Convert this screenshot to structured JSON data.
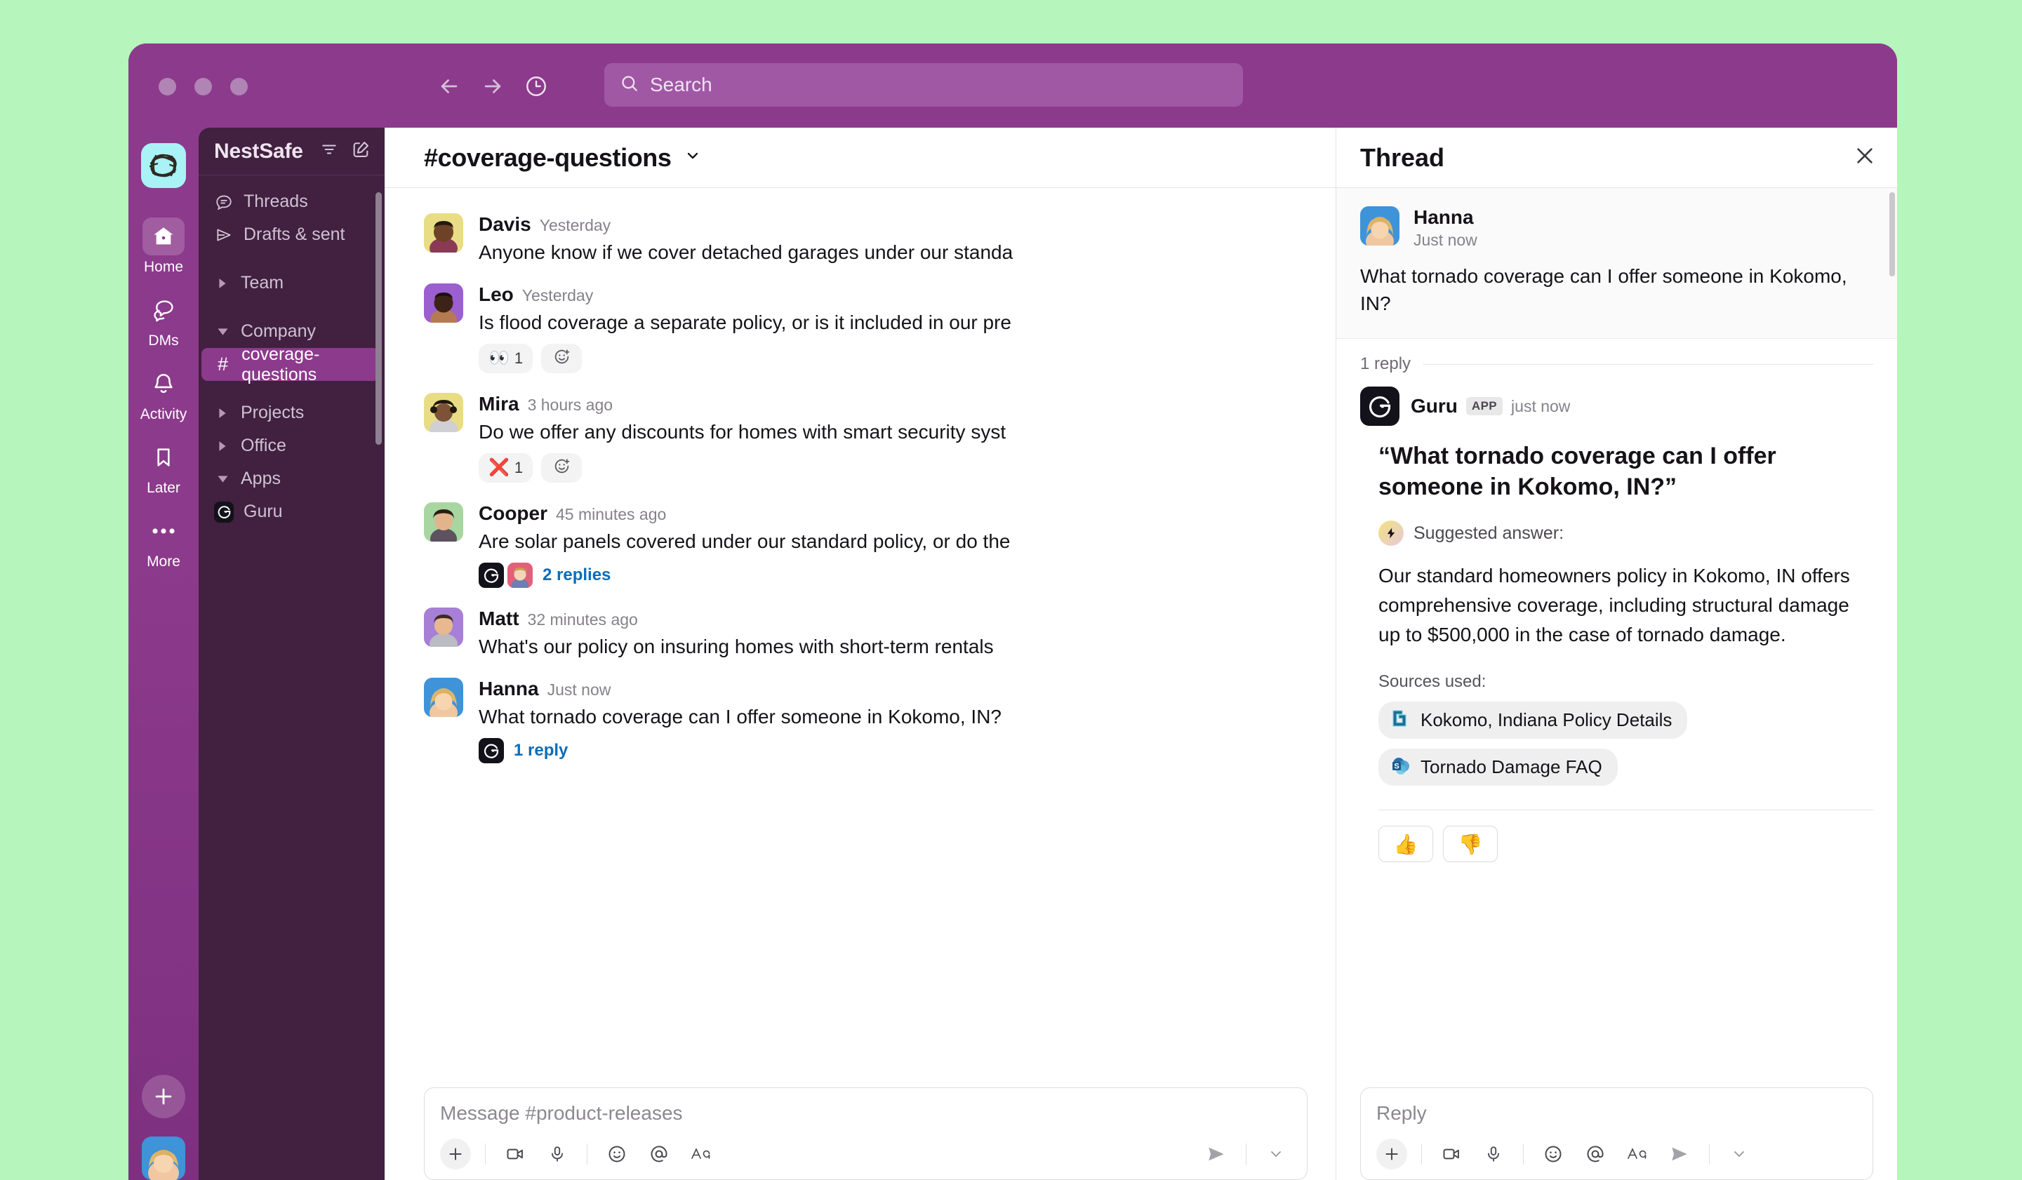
{
  "topbar": {
    "search_placeholder": "Search",
    "back_icon": "arrow-left-icon",
    "forward_icon": "arrow-right-icon",
    "history_icon": "clock-icon"
  },
  "rail": {
    "workspace_name": "NestSafe",
    "items": [
      {
        "label": "Home",
        "icon": "home-icon",
        "active": true
      },
      {
        "label": "DMs",
        "icon": "dms-icon",
        "active": false
      },
      {
        "label": "Activity",
        "icon": "bell-icon",
        "active": false
      },
      {
        "label": "Later",
        "icon": "bookmark-icon",
        "active": false
      },
      {
        "label": "More",
        "icon": "ellipsis-icon",
        "active": false
      }
    ],
    "new_label": "+"
  },
  "sidebar": {
    "title": "NestSafe",
    "filter_icon": "filter-icon",
    "compose_icon": "compose-icon",
    "items": [
      {
        "label": "Threads",
        "type": "nav",
        "icon": "threads-icon"
      },
      {
        "label": "Drafts & sent",
        "type": "nav",
        "icon": "drafts-icon"
      },
      {
        "label": "Team",
        "type": "section",
        "expanded": false
      },
      {
        "label": "Company",
        "type": "section",
        "expanded": true
      },
      {
        "label": "coverage-questions",
        "type": "channel",
        "active": true
      },
      {
        "label": "Projects",
        "type": "section",
        "expanded": false
      },
      {
        "label": "Office",
        "type": "section",
        "expanded": false
      },
      {
        "label": "Apps",
        "type": "section",
        "expanded": true
      },
      {
        "label": "Guru",
        "type": "app",
        "icon": "guru-icon"
      }
    ]
  },
  "channel": {
    "name": "#coverage-questions",
    "chevron_icon": "chevron-down-icon",
    "messages": [
      {
        "author": "Davis",
        "time": "Yesterday",
        "text": "Anyone know if we cover detached garages under our standa",
        "avatar_bg": "#e8dd84"
      },
      {
        "author": "Leo",
        "time": "Yesterday",
        "text": "Is flood coverage a separate policy, or is it included in our pre",
        "avatar_bg": "#9b5fd0",
        "reactions": [
          {
            "emoji": "👀",
            "count": "1"
          }
        ]
      },
      {
        "author": "Mira",
        "time": "3 hours ago",
        "text": "Do we offer any discounts for homes with smart security syst",
        "avatar_bg": "#e8dd84",
        "reactions": [
          {
            "emoji": "❌",
            "count": "1"
          }
        ]
      },
      {
        "author": "Cooper",
        "time": "45 minutes ago",
        "text": "Are solar panels covered under our standard policy, or do the",
        "avatar_bg": "#a8d6a0",
        "thread": {
          "count": "2 replies",
          "faces": [
            "guru",
            "#e2607a"
          ]
        }
      },
      {
        "author": "Matt",
        "time": "32 minutes ago",
        "text": "What's our policy on insuring homes with short-term rentals",
        "avatar_bg": "#a77fd6"
      },
      {
        "author": "Hanna",
        "time": "Just now",
        "text": "What tornado coverage can I offer someone in Kokomo, IN?",
        "avatar_bg": "#3f93d8",
        "thread": {
          "count": "1 reply",
          "faces": [
            "guru"
          ]
        }
      }
    ],
    "composer": {
      "placeholder": "Message #product-releases",
      "tools": [
        "plus-icon",
        "video-icon",
        "microphone-icon",
        "emoji-icon",
        "mention-icon",
        "formatting-icon"
      ],
      "send_icon": "send-icon",
      "send_options_icon": "chevron-down-icon"
    }
  },
  "thread": {
    "title": "Thread",
    "close_icon": "close-icon",
    "root": {
      "author": "Hanna",
      "time": "Just now",
      "text": "What tornado coverage can I offer someone in Kokomo, IN?",
      "avatar_bg": "#3f93d8"
    },
    "reply_divider": "1 reply",
    "reply": {
      "author": "Guru",
      "badge": "APP",
      "time": "just now",
      "card": {
        "question": "“What tornado coverage can I offer someone in Kokomo, IN?”",
        "suggested_label": "Suggested answer:",
        "suggested_icon": "lightning-icon",
        "answer": "Our standard homeowners policy in Kokomo, IN offers comprehensive coverage, including structural damage up to $500,000  in the case of tornado damage.",
        "sources_label": "Sources used:",
        "sources": [
          {
            "title": "Kokomo, Indiana Policy Details",
            "icon": "guru-source-icon"
          },
          {
            "title": "Tornado Damage FAQ",
            "icon": "sharepoint-icon"
          }
        ],
        "feedback": [
          {
            "emoji": "👍",
            "name": "thumbs-up-button"
          },
          {
            "emoji": "👎",
            "name": "thumbs-down-button"
          }
        ]
      }
    },
    "composer": {
      "placeholder": "Reply",
      "tools": [
        "plus-icon",
        "video-icon",
        "microphone-icon",
        "emoji-icon",
        "mention-icon",
        "formatting-icon"
      ],
      "send_icon": "send-icon",
      "send_options_icon": "chevron-down-icon"
    }
  },
  "colors": {
    "window_chrome": "#8c3a8c",
    "sidebar_bg": "#412040",
    "accent_link": "#0b6dba",
    "page_bg": "#b6f5bb",
    "workspace_logo_bg": "#a9f2f5"
  }
}
